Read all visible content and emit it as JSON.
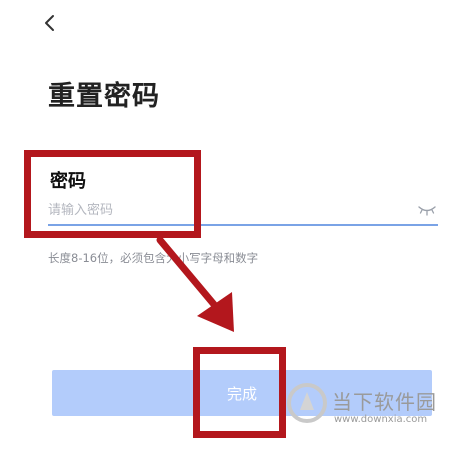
{
  "header": {
    "back_icon": "chevron-left-icon"
  },
  "page": {
    "title": "重置密码"
  },
  "form": {
    "password_label": "密码",
    "password_placeholder": "请输入密码",
    "password_value": "",
    "visibility_icon": "eye-closed-icon",
    "hint": "长度8-16位，必须包含大小写字母和数字",
    "submit_label": "完成"
  },
  "colors": {
    "accent": "#7aa3e6",
    "button_disabled": "#b3ccfb",
    "annotation": "#b3171d"
  },
  "watermark": {
    "name": "当下软件园",
    "url": "www.downxia.com"
  }
}
